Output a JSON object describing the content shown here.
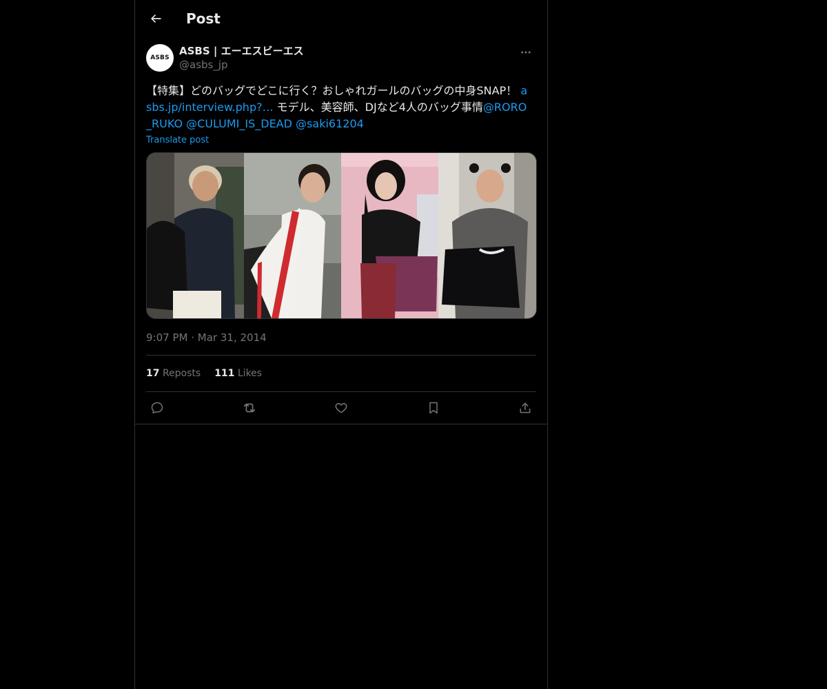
{
  "header": {
    "title": "Post",
    "back_icon": "arrow-left-icon"
  },
  "author": {
    "display_name": "ASBS | エーエスビーエス",
    "handle": "@asbs_jp",
    "avatar_text": "ASBS"
  },
  "post": {
    "text_part1": "【特集】どのバッグでどこに行く？おしゃれガールのバッグの中身SNAP！ ",
    "link": "asbs.jp/interview.php?…",
    "text_part2": " モデル、美容師、DJなど4人のバッグ事情",
    "mentions": [
      "@RORO_RUKO",
      "@CULUMI_IS_DEAD",
      "@saki61204"
    ],
    "translate_label": "Translate post",
    "timestamp_time": "9:07 PM",
    "timestamp_sep": "·",
    "timestamp_date": "Mar 31, 2014"
  },
  "stats": {
    "reposts_count": "17",
    "reposts_label": "Reposts",
    "likes_count": "111",
    "likes_label": "Likes"
  },
  "colors": {
    "background": "#000000",
    "text": "#e7e9ea",
    "secondary": "#71767b",
    "link": "#1d9bf0",
    "border": "#2f3336"
  },
  "actions": [
    "reply-icon",
    "repost-icon",
    "like-icon",
    "bookmark-icon",
    "share-icon"
  ]
}
